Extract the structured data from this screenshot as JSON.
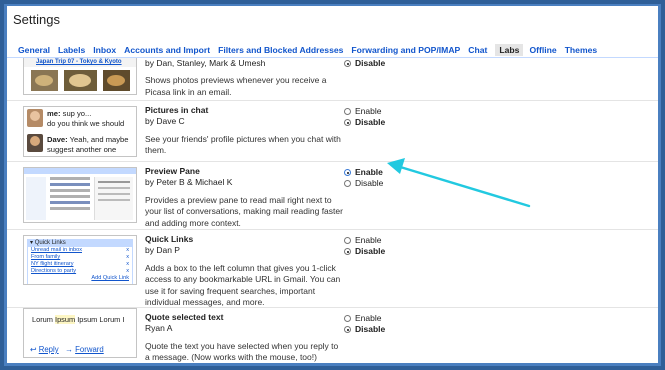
{
  "window": {
    "title": "Settings"
  },
  "tabs": [
    {
      "label": "General"
    },
    {
      "label": "Labels"
    },
    {
      "label": "Inbox"
    },
    {
      "label": "Accounts and Import"
    },
    {
      "label": "Filters and Blocked Addresses"
    },
    {
      "label": "Forwarding and POP/IMAP"
    },
    {
      "label": "Chat"
    },
    {
      "label": "Labs",
      "active": true
    },
    {
      "label": "Offline"
    },
    {
      "label": "Themes"
    }
  ],
  "labs": {
    "picasa": {
      "thumb_caption": "Japan Trip 07 - Tokyo & Kyoto",
      "author": "by Dan, Stanley, Mark & Umesh",
      "description": "Shows photos previews whenever you receive a Picasa link in an email.",
      "disable": "Disable",
      "selected": "disable"
    },
    "pictures_in_chat": {
      "name": "Pictures in chat",
      "author": "by Dave C",
      "description": "See your friends' profile pictures when you chat with them.",
      "enable": "Enable",
      "disable": "Disable",
      "selected": "disable",
      "thumb": {
        "line1_name": "me:",
        "line1_text": "sup yo...",
        "line2_text": "do you think we should",
        "line3_name": "Dave:",
        "line3_text": "Yeah, and maybe",
        "line4_text": "suggest another one"
      }
    },
    "preview_pane": {
      "name": "Preview Pane",
      "author": "by Peter B & Michael K",
      "description": "Provides a preview pane to read mail right next to your list of conversations, making mail reading faster and adding more context.",
      "enable": "Enable",
      "disable": "Disable",
      "selected": "enable"
    },
    "quick_links": {
      "name": "Quick Links",
      "author": "by Dan P",
      "description": "Adds a box to the left column that gives you 1-click access to any bookmarkable URL in Gmail. You can use it for saving frequent searches, important individual messages, and more.",
      "enable": "Enable",
      "disable": "Disable",
      "selected": "disable",
      "thumb": {
        "header": "Quick Links",
        "links": [
          "Unread mail in inbox",
          "From family",
          "NY flight itinerary",
          "Directions to party"
        ],
        "remove": "x",
        "add": "Add Quick Link"
      }
    },
    "quote_selected": {
      "name": "Quote selected text",
      "author": "Ryan A",
      "description": "Quote the text you have selected when you reply to a message. (Now works with the mouse, too!)",
      "enable": "Enable",
      "disable": "Disable",
      "selected": "disable",
      "thumb": {
        "lorem_a": "Lorum ",
        "lorem_b": "Ipsum",
        "lorem_c": " Ipsum Lorum I",
        "reply": "Reply",
        "forward": "Forward",
        "reply_arrow": "↩",
        "forward_arrow": "→"
      }
    }
  },
  "colors": {
    "accent_arrow": "#22c9e0",
    "link": "#1155cc",
    "frame": "#4a7fc0"
  }
}
